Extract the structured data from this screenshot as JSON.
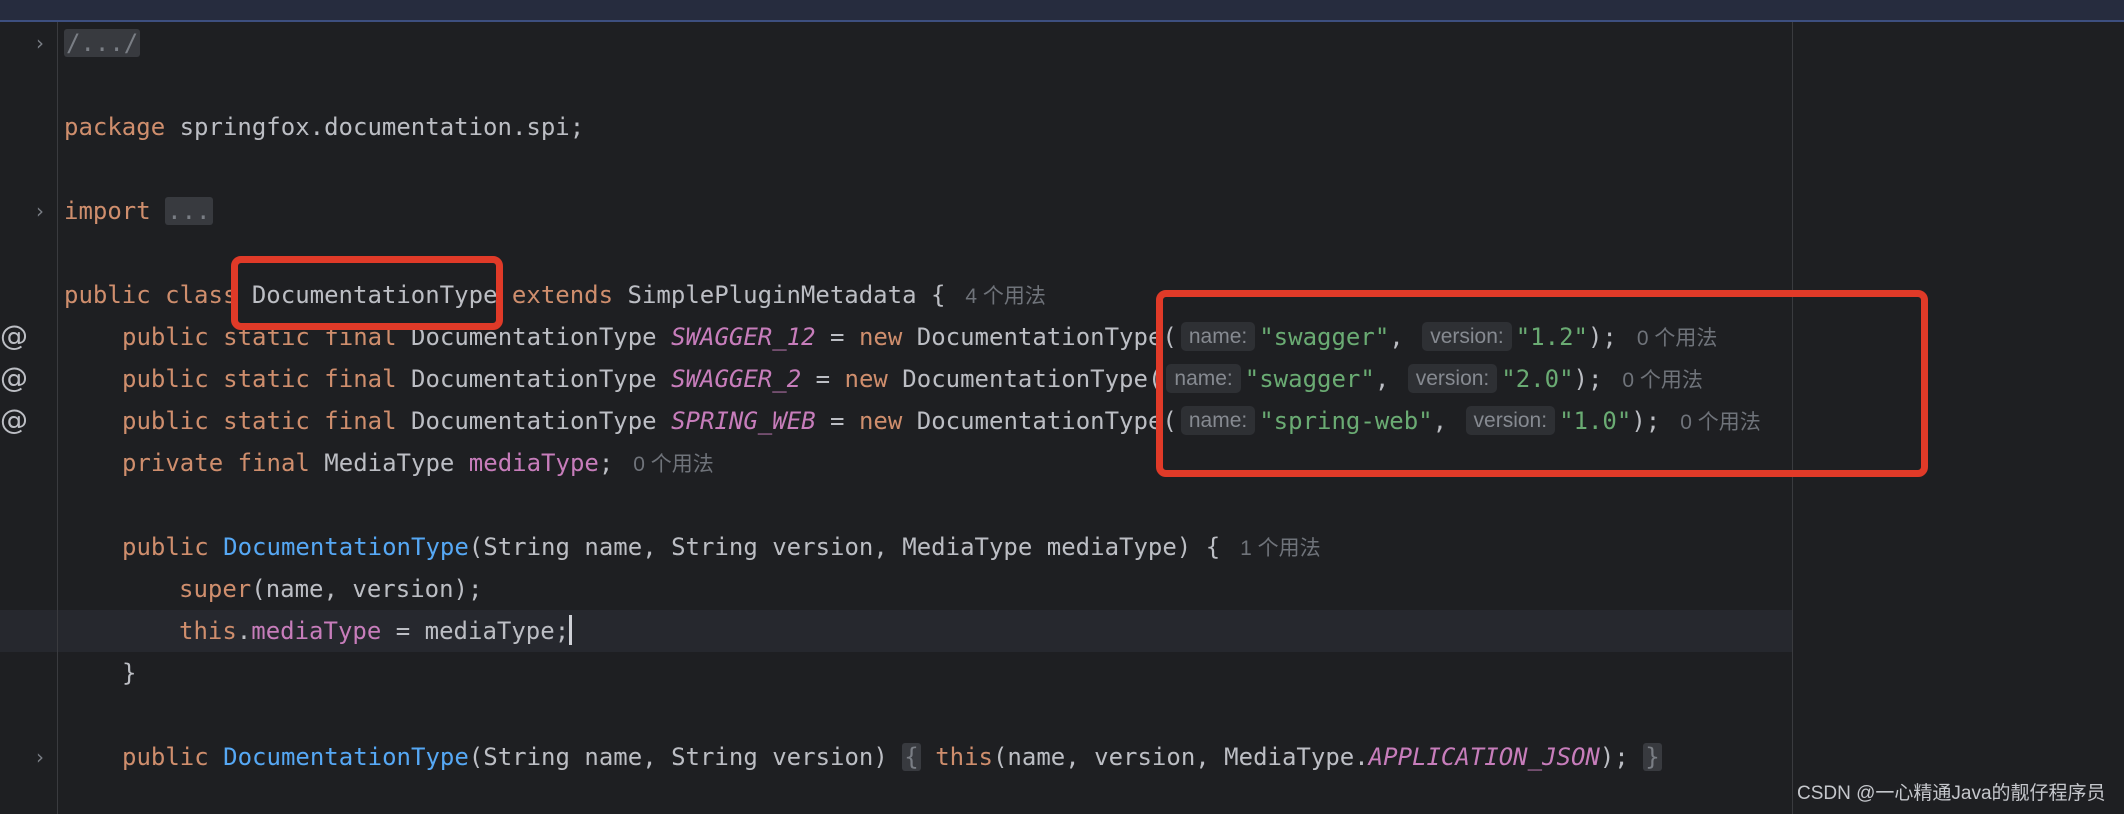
{
  "editor": {
    "lines": {
      "l1": {
        "fold": "/.../"
      },
      "l2": {
        "kw": "package",
        "pkg": " springfox.documentation.spi;"
      },
      "l3": {
        "kw": "import",
        "fold": "..."
      },
      "l4": {
        "kw1": "public class ",
        "cls": "DocumentationType",
        "kw2": " extends",
        "base": " SimplePluginMetadata {",
        "usage": "4 个用法"
      },
      "l5": {
        "kw": "public static final",
        "type": " DocumentationType ",
        "name": "SWAGGER_12",
        "eq": " = ",
        "new": "new",
        "ctor": " DocumentationType(",
        "hint_name": "name:",
        "arg1": "\"swagger\"",
        "comma": ",",
        "hint_version": "version:",
        "arg2": "\"1.2\"",
        "end": ");",
        "usage": "0 个用法"
      },
      "l6": {
        "kw": "public static final",
        "type": " DocumentationType ",
        "name": "SWAGGER_2",
        "eq": " = ",
        "new": "new",
        "ctor": " DocumentationType(",
        "hint_name": "name:",
        "arg1": "\"swagger\"",
        "comma": ",",
        "hint_version": "version:",
        "arg2": "\"2.0\"",
        "end": ");",
        "usage": "0 个用法"
      },
      "l7": {
        "kw": "public static final",
        "type": " DocumentationType ",
        "name": "SPRING_WEB",
        "eq": " = ",
        "new": "new",
        "ctor": " DocumentationType(",
        "hint_name": "name:",
        "arg1": "\"spring-web\"",
        "comma": ",",
        "hint_version": "version:",
        "arg2": "\"1.0\"",
        "end": ");",
        "usage": "0 个用法"
      },
      "l8": {
        "kw": "private final",
        "type": " MediaType ",
        "field": "mediaType",
        "end": ";",
        "usage": "0 个用法"
      },
      "l9": {
        "kw": "public",
        "ctor": " DocumentationType",
        "params": "(String name, String version, MediaType mediaType) {",
        "usage": "1 个用法"
      },
      "l10": {
        "kw": "super",
        "rest": "(name, version);"
      },
      "l11": {
        "kw": "this",
        "dot": ".",
        "field": "mediaType",
        "rest": " = mediaType;"
      },
      "l12": {
        "text": "}"
      },
      "l13": {
        "kw": "public",
        "ctor": " DocumentationType",
        "params": "(String name, String version) ",
        "lbrace": "{",
        "this": "this",
        "args": "(name, version, MediaType.",
        "const": "APPLICATION_JSON",
        "close": ");",
        "rbrace": "}"
      }
    },
    "colors": {
      "keyword": "#cf8e6d",
      "string": "#6aab73",
      "field": "#c77dbb",
      "method": "#56a8f5",
      "annotation_box": "#e03a28"
    },
    "icons": {
      "fold": "chevron-right-icon",
      "annotation": "at-icon"
    }
  },
  "watermark": "CSDN @一心精通Java的靓仔程序员"
}
